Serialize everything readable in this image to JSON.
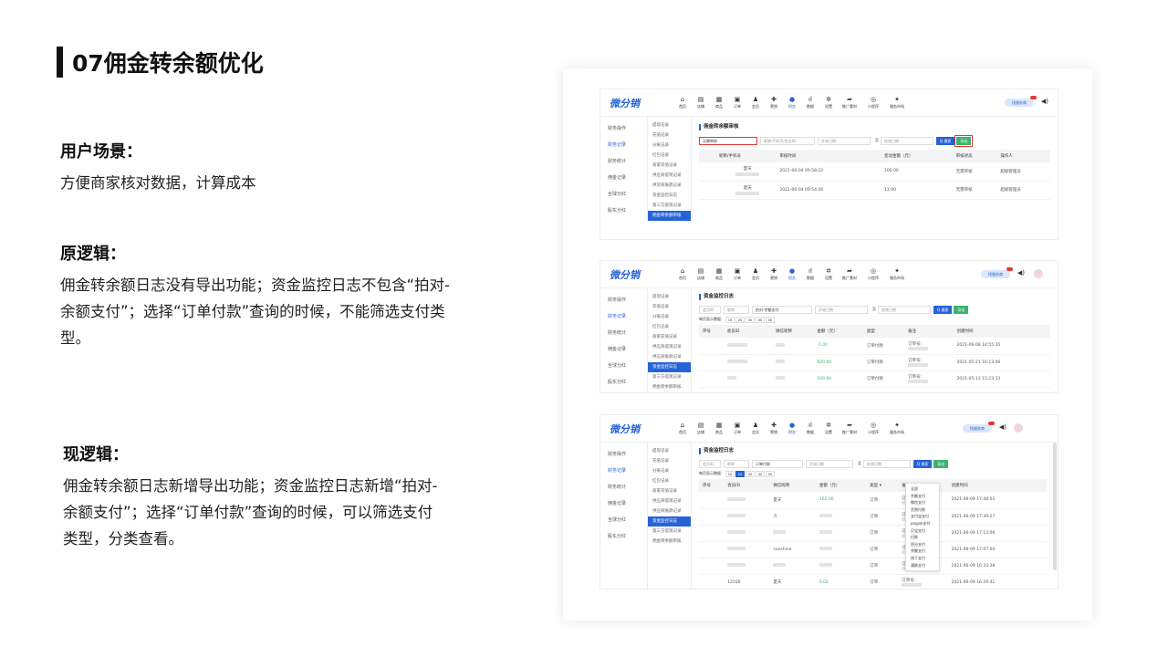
{
  "slide": {
    "title": "07佣金转余额优化",
    "user_scene_h": "用户场景：",
    "user_scene_p": "方便商家核对数据，计算成本",
    "old_h": "原逻辑：",
    "old_p": "佣金转余额日志没有导出功能；资金监控日志不包含“拍对-余额支付”；选择“订单付款”查询的时候，不能筛选支付类型。",
    "new_h": "现逻辑：",
    "new_p": "佣金转余额日志新增导出功能；资金监控日志新增“拍对-余额支付”；选择“订单付款”查询的时候，可以筛选支付类型，分类查看。"
  },
  "app": {
    "logo": "微分销",
    "nav": [
      "首页",
      "店铺",
      "商品",
      "订单",
      "会员",
      "营销",
      "财务",
      "数据",
      "设置",
      "推广素材",
      "小程序",
      "服务市场"
    ],
    "nav_icons": [
      "⌂",
      "▤",
      "▦",
      "▣",
      "♟",
      "✚",
      "●",
      "ıl",
      "✲",
      "➦",
      "◎",
      "✦"
    ],
    "pill": "找服务商",
    "speaker": "◀)",
    "side1": [
      "财务操作",
      "财务记录",
      "财务统计",
      "佣金记录",
      "全球分红",
      "股东分红"
    ],
    "side2_a": [
      "提现记录",
      "充值记录",
      "分账记录",
      "红包记录",
      "商家充值记录",
      "供应商提现记录",
      "供货商账款记录",
      "资金监控日志",
      "第三方提现记录",
      "佣金转余额审核"
    ],
    "side2_b": [
      "提现记录",
      "充值记录",
      "分账记录",
      "红包记录",
      "商家充值记录",
      "供应商提现记录",
      "供应商账款记录",
      "资金监控日志",
      "第三方提现记录",
      "佣金转余额审核"
    ]
  },
  "shot1": {
    "page_title": "佣金转余额审核",
    "filter_select": "无需审核",
    "filter_input": "昵称/手机号/会员ID",
    "date_start": "开始日期",
    "date_sep": "至",
    "date_end": "结束日期",
    "search_btn": "Q 搜索",
    "export_btn": "导出",
    "headers": [
      "昵称/手机号",
      "审核时间",
      "变动金额（元）",
      "审核状态",
      "操作人"
    ],
    "rows": [
      {
        "name": "夏天",
        "time": "2021-06-04 09:58:22",
        "amount": "100.00",
        "status": "无需审核",
        "op": "超级管理员"
      },
      {
        "name": "夏天",
        "time": "2021-06-04 09:54:00",
        "amount": "11.00",
        "status": "无需审核",
        "op": "超级管理员"
      }
    ]
  },
  "shot2": {
    "page_title": "资金监控日志",
    "f1": "会员ID",
    "f2": "昵称",
    "f3": "拍对-余额支付",
    "f4": "开始日期",
    "f5": "结束日期",
    "per_page_label": "每页显示数据：",
    "pages": [
      "10",
      "20",
      "30",
      "40",
      "50"
    ],
    "headers": [
      "序号",
      "会员ID",
      "微信昵称",
      "金额（元）",
      "类型",
      "备注",
      "创建时间"
    ],
    "rows": [
      {
        "amount": "-1.00",
        "type": "订单付款",
        "note": "订单号：",
        "time": "2021-06-08 14:55:35"
      },
      {
        "amount": "600.00",
        "type": "订单付款",
        "note": "订单号：",
        "time": "2021-05-21 16:13:06"
      },
      {
        "amount": "100.00",
        "type": "订单付款",
        "note": "订单号：",
        "time": "2021-05-13 15:23:13"
      }
    ]
  },
  "shot3": {
    "page_title": "资金监控日志",
    "f1": "会员ID",
    "f2": "昵称",
    "f3": "订单付款",
    "f4": "开始日期",
    "f5": "结束日期",
    "per_page_label": "每页显示数据：",
    "pages": [
      "10",
      "20",
      "30",
      "40",
      "50"
    ],
    "headers": [
      "序号",
      "会员ID",
      "微信昵称",
      "金额（元）",
      "类型 ▾",
      "备注",
      "创建时间"
    ],
    "dropdown": [
      "全部",
      "余额支付",
      "微信支付",
      "货到付款",
      "支付宝支付",
      "paypal支付",
      "贝宝支付",
      "付款",
      "积分支付",
      "余额支付",
      "线下支付",
      "通联支付"
    ],
    "rows": [
      {
        "uid": "",
        "nick": "夏天",
        "amount": "162.00",
        "type": "订单",
        "note": "订单号：",
        "time": "2021-06-09 17:48:01"
      },
      {
        "uid": "",
        "nick": "♬",
        "amount": "",
        "type": "订单",
        "note": "订单号：",
        "time": "2021-06-09 17:39:27"
      },
      {
        "uid": "",
        "nick": "",
        "amount": "",
        "type": "订单",
        "note": "订单号：",
        "time": "2021-06-09 17:12:06"
      },
      {
        "uid": "",
        "nick": "sunshine",
        "amount": "",
        "type": "订单",
        "note": "订单号：",
        "time": "2021-06-09 17:07:04"
      },
      {
        "uid": "",
        "nick": "",
        "amount": "",
        "type": "订单",
        "note": "订单号：",
        "time": "2021-06-09 16:33:28"
      },
      {
        "uid": "12106",
        "nick": "夏天",
        "amount": "0.02",
        "type": "订单",
        "note": "订单号：",
        "time": "2021-06-09 16:29:41"
      }
    ]
  }
}
